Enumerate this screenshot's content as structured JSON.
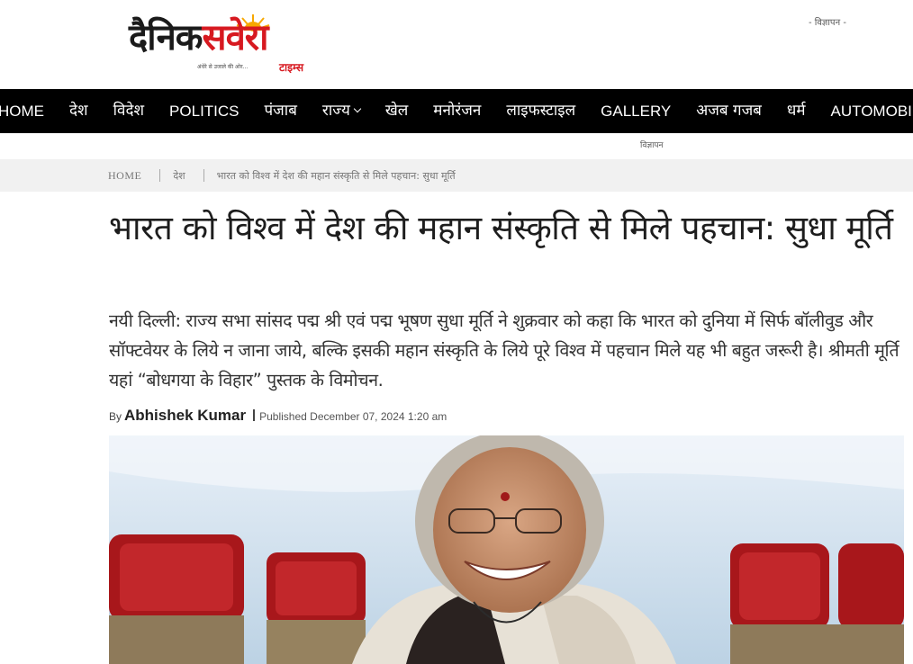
{
  "header": {
    "logo_part1": "दैनिक",
    "logo_part2": "सवेरा",
    "logo_tagline": "अंधेरे से उजाले की ओर...",
    "logo_times": "टाइम्स",
    "ad_label_top": "- विज्ञापन -",
    "ad_label_nav": "विज्ञापन"
  },
  "nav": {
    "items": [
      {
        "label": "HOME"
      },
      {
        "label": "देश"
      },
      {
        "label": "विदेश"
      },
      {
        "label": "POLITICS"
      },
      {
        "label": "पंजाब"
      },
      {
        "label": "राज्य"
      },
      {
        "label": "खेल"
      },
      {
        "label": "मनोरंजन"
      },
      {
        "label": "लाइफस्टाइल"
      },
      {
        "label": "GALLERY"
      },
      {
        "label": "अजब गजब"
      },
      {
        "label": "धर्म"
      },
      {
        "label": "AUTOMOBILE"
      }
    ]
  },
  "breadcrumb": {
    "home": "HOME",
    "category": "देश",
    "current": "भारत को विश्व में देश की महान संस्कृति से मिले पहचान: सुधा मूर्ति"
  },
  "article": {
    "title": "भारत को विश्व में देश की महान संस्कृति से मिले पहचान: सुधा मूर्ति",
    "summary": "नयी दिल्ली: राज्य सभा सांसद पद्म श्री एवं पद्म भूषण सुधा मूर्ति ने शुक्रवार को कहा कि भारत को दुनिया में सिर्फ बॉलीवुड और सॉफ्टवेयर के लिये न जाना जाये, बल्कि इसकी महान संस्कृति के लिये पूरे विश्व में पहचान मिले यह भी बहुत जरूरी है। श्रीमती मूर्ति यहां “बोधगया के विहार” पुस्तक के विमोचन.",
    "by_label": "By",
    "author": "Abhishek Kumar",
    "published": "Published December 07, 2024 1:20 am"
  },
  "colors": {
    "brand_red": "#d71920",
    "nav_bg": "#000000",
    "breadcrumb_bg": "#f1f1f1"
  }
}
